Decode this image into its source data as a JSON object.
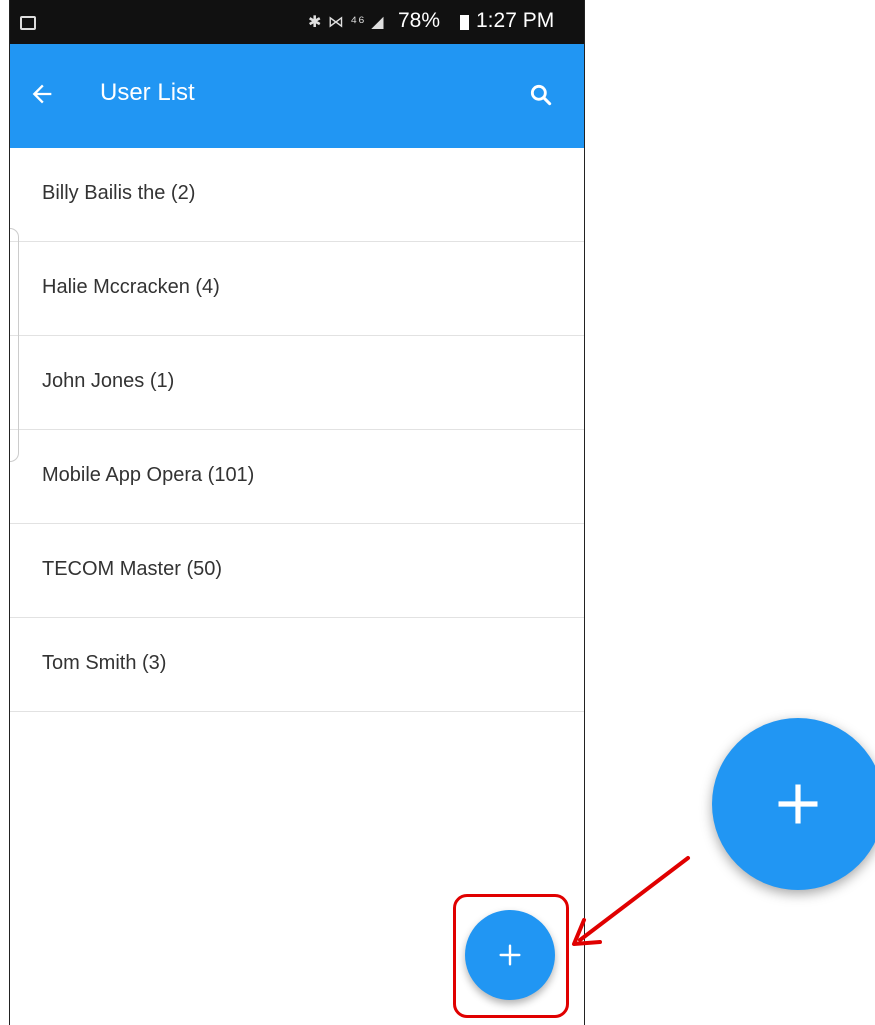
{
  "statusbar": {
    "icons": "✱ ⋈ ⁴⁶ ◢",
    "battery": "78%",
    "time": "1:27 PM"
  },
  "appbar": {
    "title": "User List",
    "back_icon": "arrow-left-icon",
    "search_icon": "search-icon"
  },
  "users": [
    "Billy Bailis the (2)",
    "Halie Mccracken (4)",
    "John Jones (1)",
    "Mobile App Opera (101)",
    "TECOM Master (50)",
    "Tom Smith (3)"
  ],
  "fab": {
    "icon": "plus-icon"
  },
  "colors": {
    "primary": "#2196F3",
    "statusbar": "#111111",
    "highlight": "#e00000"
  }
}
